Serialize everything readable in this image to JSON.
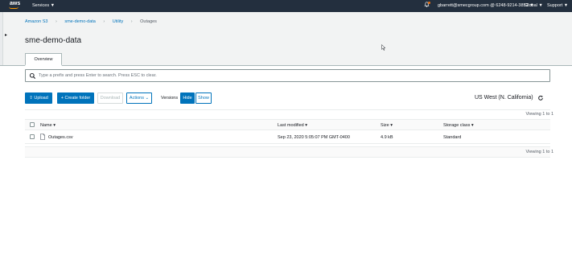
{
  "topbar": {
    "logo": "aws",
    "services": "Services ▼",
    "account": "gbarrett@smecgroup.com @ 6248-9214-3852 ▼",
    "region": "Global ▼",
    "support": "Support ▼"
  },
  "breadcrumb": {
    "items": [
      "Amazon S3",
      "sme-demo-data",
      "Utility",
      "Outages"
    ],
    "separator": "›"
  },
  "page_title": "sme-demo-data",
  "tabs": [
    "Overview"
  ],
  "search": {
    "placeholder": "Type a prefix and press Enter to search. Press ESC to clear."
  },
  "toolbar": {
    "upload": "Upload",
    "create_folder": "Create folder",
    "download": "Download",
    "actions": "Actions ⌄",
    "versions_label": "Versions",
    "hide": "Hide",
    "show": "Show"
  },
  "region_label": "US West (N. California)",
  "table": {
    "viewing_top": "Viewing 1 to 1",
    "viewing_bottom": "Viewing 1 to 1",
    "columns": [
      "Name ▾",
      "Last modified ▾",
      "Size ▾",
      "Storage class ▾"
    ],
    "rows": [
      {
        "name": "Outages.csv",
        "last_modified": "Sep 23, 2020 5:05:07 PM GMT-0400",
        "size": "4.9 kB",
        "storage_class": "Standard"
      }
    ]
  },
  "colors": {
    "topbar": "#232f3e",
    "accent": "#0073bb",
    "brand_orange": "#ff9900"
  }
}
